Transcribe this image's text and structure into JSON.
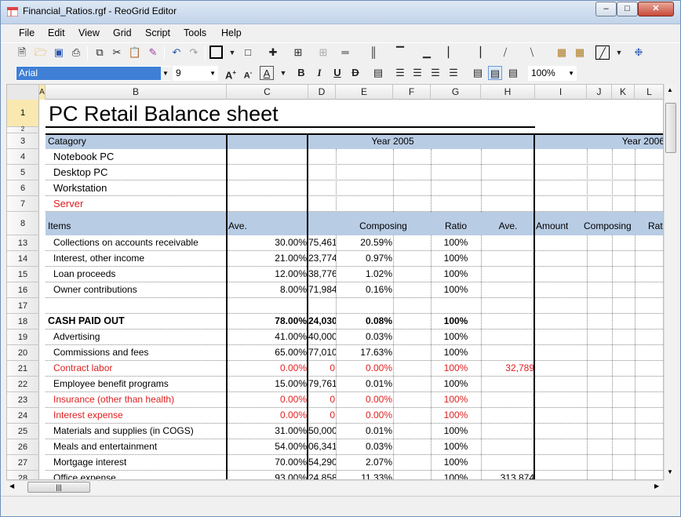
{
  "window": {
    "title": "Financial_Ratios.rgf - ReoGrid Editor",
    "minimize_label": "–",
    "maximize_label": "□",
    "close_label": "✕"
  },
  "menu": [
    "File",
    "Edit",
    "View",
    "Grid",
    "Script",
    "Tools",
    "Help"
  ],
  "toolbar": {
    "font_name": "Arial",
    "font_size": "9",
    "zoom": "100%",
    "icons": [
      "new-file-icon",
      "open-folder-icon",
      "save-icon",
      "print-preview-icon",
      "copy-icon",
      "cut-icon",
      "paste-icon",
      "format-painter-icon",
      "undo-icon",
      "redo-icon"
    ]
  },
  "columns": [
    {
      "name": "A"
    },
    {
      "name": "B"
    },
    {
      "name": "C"
    },
    {
      "name": "D"
    },
    {
      "name": "E"
    },
    {
      "name": "F"
    },
    {
      "name": "G"
    },
    {
      "name": "H"
    },
    {
      "name": "I"
    },
    {
      "name": "J"
    },
    {
      "name": "K"
    },
    {
      "name": "L"
    }
  ],
  "sheet": {
    "title": "PC Retail Balance sheet",
    "header_row3": {
      "category": "Catagory",
      "year_a": "Year 2005",
      "year_b": "Year 2006"
    },
    "categories": [
      {
        "row": "4",
        "label": "Notebook PC",
        "red": false
      },
      {
        "row": "5",
        "label": "Desktop PC",
        "red": false
      },
      {
        "row": "6",
        "label": "Workstation",
        "red": false
      },
      {
        "row": "7",
        "label": "Server",
        "red": true
      }
    ],
    "header_row8": {
      "items": "Items",
      "ave": "Ave.",
      "composing": "Composing",
      "ratio": "Ratio",
      "ave2": "Ave.",
      "amount": "Amount",
      "composing2": "Composing",
      "ratio2": "Rat"
    },
    "rows": [
      {
        "row": "13",
        "item": "Collections on accounts receivable",
        "ave": "30.00%",
        "amount": "75,461",
        "composing": "20.59%",
        "ratio": "100%",
        "h": "",
        "red": false,
        "bold": false
      },
      {
        "row": "14",
        "item": "Interest, other income",
        "ave": "21.00%",
        "amount": "23,774",
        "composing": "0.97%",
        "ratio": "100%",
        "h": "",
        "red": false,
        "bold": false
      },
      {
        "row": "15",
        "item": "Loan proceeds",
        "ave": "12.00%",
        "amount": "38,776",
        "composing": "1.02%",
        "ratio": "100%",
        "h": "",
        "red": false,
        "bold": false
      },
      {
        "row": "16",
        "item": "Owner contributions",
        "ave": "8.00%",
        "amount": "71,984",
        "composing": "0.16%",
        "ratio": "100%",
        "h": "",
        "red": false,
        "bold": false
      },
      {
        "row": "17",
        "item": "",
        "ave": "",
        "amount": "",
        "composing": "",
        "ratio": "",
        "h": "",
        "red": false,
        "bold": false
      },
      {
        "row": "18",
        "item": "CASH PAID OUT",
        "ave": "78.00%",
        "amount": "24,030",
        "composing": "0.08%",
        "ratio": "100%",
        "h": "",
        "red": false,
        "bold": true
      },
      {
        "row": "19",
        "item": "Advertising",
        "ave": "41.00%",
        "amount": "40,000",
        "composing": "0.03%",
        "ratio": "100%",
        "h": "",
        "red": false,
        "bold": false
      },
      {
        "row": "20",
        "item": "Commissions and fees",
        "ave": "65.00%",
        "amount": "77,010",
        "composing": "17.63%",
        "ratio": "100%",
        "h": "",
        "red": false,
        "bold": false
      },
      {
        "row": "21",
        "item": "Contract labor",
        "ave": "0.00%",
        "amount": "0",
        "composing": "0.00%",
        "ratio": "100%",
        "h": "32,789",
        "red": true,
        "bold": false
      },
      {
        "row": "22",
        "item": "Employee benefit programs",
        "ave": "15.00%",
        "amount": "79,761",
        "composing": "0.01%",
        "ratio": "100%",
        "h": "",
        "red": false,
        "bold": false
      },
      {
        "row": "23",
        "item": "Insurance (other than health)",
        "ave": "0.00%",
        "amount": "0",
        "composing": "0.00%",
        "ratio": "100%",
        "h": "",
        "red": true,
        "bold": false
      },
      {
        "row": "24",
        "item": "Interest expense",
        "ave": "0.00%",
        "amount": "0",
        "composing": "0.00%",
        "ratio": "100%",
        "h": "",
        "red": true,
        "bold": false
      },
      {
        "row": "25",
        "item": "Materials and supplies (in COGS)",
        "ave": "31.00%",
        "amount": "50,000",
        "composing": "0.01%",
        "ratio": "100%",
        "h": "",
        "red": false,
        "bold": false
      },
      {
        "row": "26",
        "item": "Meals and entertainment",
        "ave": "54.00%",
        "amount": "06,341",
        "composing": "0.03%",
        "ratio": "100%",
        "h": "",
        "red": false,
        "bold": false
      },
      {
        "row": "27",
        "item": "Mortgage interest",
        "ave": "70.00%",
        "amount": "54,290",
        "composing": "2.07%",
        "ratio": "100%",
        "h": "",
        "red": false,
        "bold": false
      },
      {
        "row": "28",
        "item": "Office expense",
        "ave": "93.00%",
        "amount": "24,858",
        "composing": "11.33%",
        "ratio": "100%",
        "h": "313,874",
        "red": false,
        "bold": false
      }
    ]
  },
  "colors": {
    "band": "#b8cce4",
    "negative": "#e02020",
    "selected_header": "#f9e8b0"
  }
}
